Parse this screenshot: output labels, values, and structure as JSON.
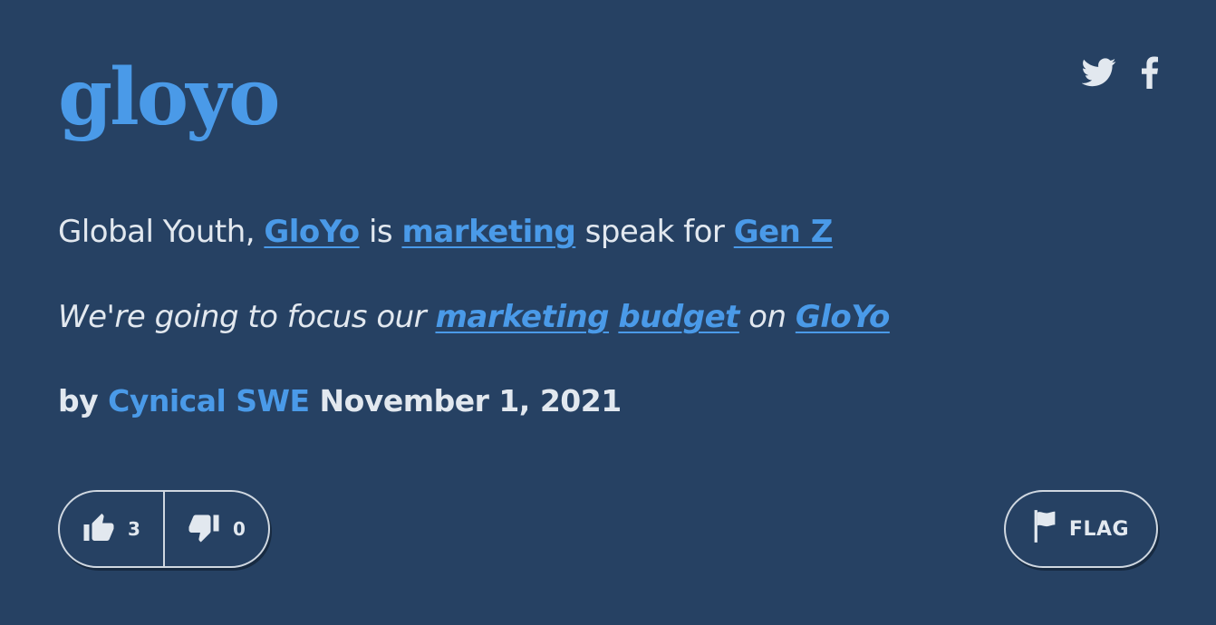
{
  "definition": {
    "word": "gloyo",
    "meaning": {
      "text_1": "Global Youth, ",
      "link_1": "GloYo",
      "text_2": " is ",
      "link_2": "marketing",
      "text_3": " speak for ",
      "link_3": "Gen Z"
    },
    "example": {
      "text_1": "We're going to focus our ",
      "link_1": "marketing",
      "text_2": " ",
      "link_2": "budget",
      "text_3": " on ",
      "link_3": "GloYo"
    },
    "contributor": {
      "prefix": "by",
      "author": "Cynical SWE",
      "date": "November 1, 2021"
    },
    "votes": {
      "up_count": "3",
      "down_count": "0"
    },
    "flag_label": "FLAG"
  },
  "share": {
    "icons": [
      "twitter-icon",
      "facebook-icon"
    ]
  },
  "colors": {
    "background": "#264163",
    "accent": "#4a9ae8",
    "text": "#e2e8ef"
  }
}
